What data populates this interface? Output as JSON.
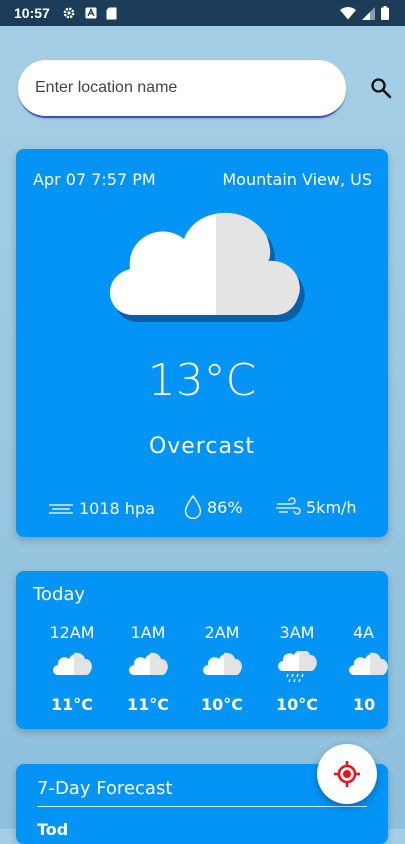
{
  "status_bar": {
    "time": "10:57"
  },
  "search": {
    "placeholder": "Enter location name"
  },
  "current": {
    "datetime": "Apr 07 7:57 PM",
    "location": "Mountain View, US",
    "temperature": "13°C",
    "condition": "Overcast",
    "condition_icon": "cloud-icon",
    "pressure": "1018 hpa",
    "humidity": "86%",
    "wind": "5km/h"
  },
  "today": {
    "title": "Today",
    "hours": [
      {
        "time": "12AM",
        "temp": "11°C",
        "icon": "cloud-icon"
      },
      {
        "time": "1AM",
        "temp": "11°C",
        "icon": "cloud-icon"
      },
      {
        "time": "2AM",
        "temp": "10°C",
        "icon": "cloud-icon"
      },
      {
        "time": "3AM",
        "temp": "10°C",
        "icon": "rain-cloud-icon"
      },
      {
        "time": "4A",
        "temp": "10",
        "icon": "cloud-icon"
      }
    ]
  },
  "forecast": {
    "title": "7-Day Forecast",
    "first_day": "Tod"
  },
  "colors": {
    "card": "#0394f5",
    "background": "#9cc9e2",
    "status_bar": "#1c3d5a",
    "fab_icon": "#e8141c",
    "search_underline": "#3f51b5"
  }
}
